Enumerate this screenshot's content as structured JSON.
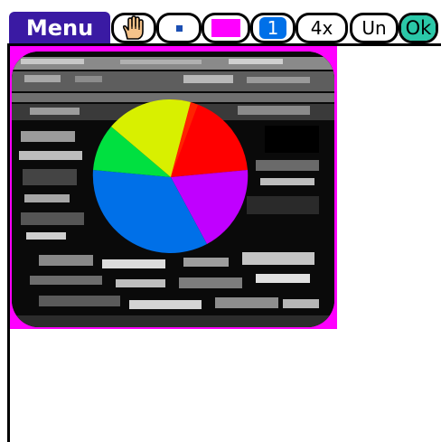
{
  "toolbar": {
    "menu_label": "Menu",
    "line_width": "1",
    "zoom": "4x",
    "undo_label": "Un",
    "ok_label": "Ok",
    "icons": {
      "hand": "hand-icon",
      "brush": "brush-dot-icon",
      "color": "color-swatch-icon"
    },
    "colors": {
      "menu_bg": "#3a1aa3",
      "swatch": "#ff00ff",
      "line_chip": "#0070e8",
      "ok_chip": "#2ac8a8"
    }
  },
  "canvas": {
    "background_color": "#ff00ff",
    "picture": "grayscale-screenshot-with-pie-chart",
    "pie_slice_colors": [
      "#ff0000",
      "#c000ff",
      "#0070e8",
      "#00e040",
      "#d8f000"
    ]
  }
}
